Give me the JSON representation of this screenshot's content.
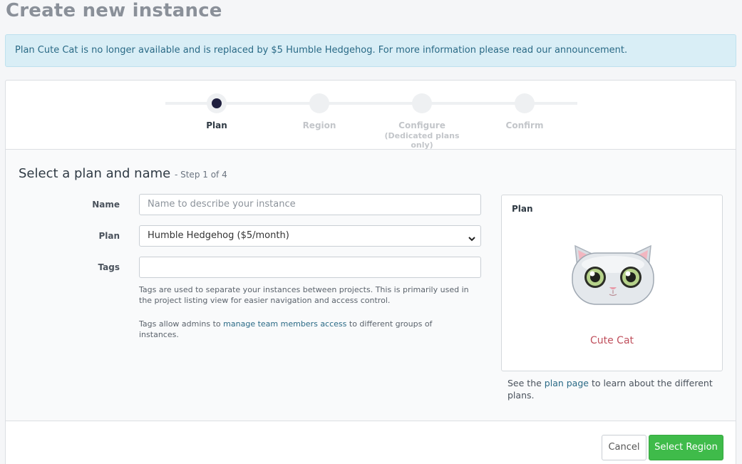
{
  "page": {
    "title": "Create new instance"
  },
  "notice": {
    "text_before": "Plan Cute Cat is no longer available and is replaced by $5 Humble Hedgehog. For more information please read our ",
    "link": "announcement",
    "text_after": "."
  },
  "stepper": {
    "steps": [
      {
        "label": "Plan",
        "sub": "",
        "active": true
      },
      {
        "label": "Region",
        "sub": "",
        "active": false
      },
      {
        "label": "Configure",
        "sub": "(Dedicated plans only)",
        "active": false
      },
      {
        "label": "Confirm",
        "sub": "",
        "active": false
      }
    ]
  },
  "form": {
    "section_title": "Select a plan and name",
    "step_note": "- Step 1 of 4",
    "name_label": "Name",
    "name_placeholder": "Name to describe your instance",
    "name_value": "",
    "plan_label": "Plan",
    "plan_selected": "Humble Hedgehog ($5/month)",
    "tags_label": "Tags",
    "tags_value": "",
    "tags_help_1": "Tags are used to separate your instances between projects. This is primarily used in the project listing view for easier navigation and access control.",
    "tags_help_2_before": "Tags allow admins to ",
    "tags_help_2_link": "manage team members access",
    "tags_help_2_after": " to different groups of instances."
  },
  "plan_box": {
    "title": "Plan",
    "plan_name": "Cute Cat",
    "note_before": "See the ",
    "note_link": "plan page",
    "note_after": " to learn about the different plans."
  },
  "footer": {
    "cancel_label": "Cancel",
    "next_label": "Select Region"
  },
  "colors": {
    "primary_button": "#3fbb4a",
    "notice_bg": "#d9eef6",
    "plan_name": "#c0505d",
    "active_step": "#20203f"
  }
}
